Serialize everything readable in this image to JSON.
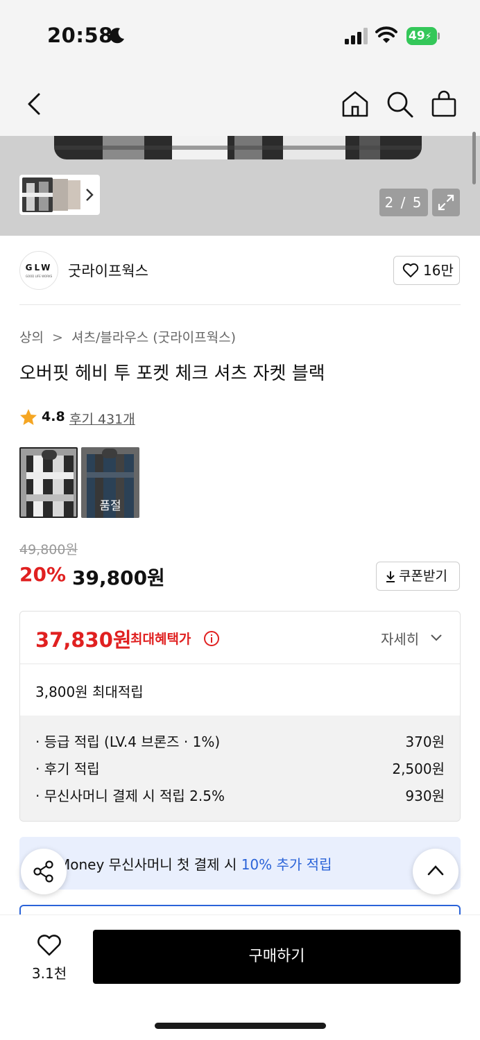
{
  "status": {
    "time": "20:58",
    "battery": "49"
  },
  "gallery": {
    "counter": "2 / 5"
  },
  "brand": {
    "logo_text": "GLW",
    "logo_subtext": "GOOD LIFE WORKS",
    "name": "굿라이프웍스",
    "likes": "16만"
  },
  "breadcrumb": {
    "category": "상의",
    "subcategory": "셔츠/블라우스 (굿라이프웍스)"
  },
  "product": {
    "title": "오버핏 헤비 투 포켓 체크 셔츠 자켓 블랙",
    "rating": "4.8",
    "review_link": "후기 431개",
    "options": [
      {
        "name": "블랙"
      },
      {
        "name": "블루",
        "badge": "품절"
      }
    ]
  },
  "price": {
    "original": "49,800원",
    "discount": "20%",
    "current": "39,800원",
    "coupon_label": "쿠폰받기"
  },
  "benefit": {
    "max_price": "37,830원",
    "max_label": "최대혜택가",
    "detail_label": "자세히",
    "points_total": "3,800원 최대적립",
    "points": [
      {
        "label": "· 등급 적립 (LV.4 브론즈 · 1%)",
        "amount": "370원"
      },
      {
        "label": "· 후기 적립",
        "amount": "2,500원"
      },
      {
        "label": "· 무신사머니 결제 시 적립 2.5%",
        "amount": "930원"
      }
    ]
  },
  "banner": {
    "prefix": "Money 무신사머니 첫 결제 시 ",
    "highlight": "10% 추가 적립"
  },
  "bottom": {
    "wish_count": "3.1천",
    "buy_label": "구매하기"
  },
  "colors": {
    "accent_red": "#e02020",
    "link_blue": "#2a63d8",
    "battery_green": "#34c759"
  }
}
